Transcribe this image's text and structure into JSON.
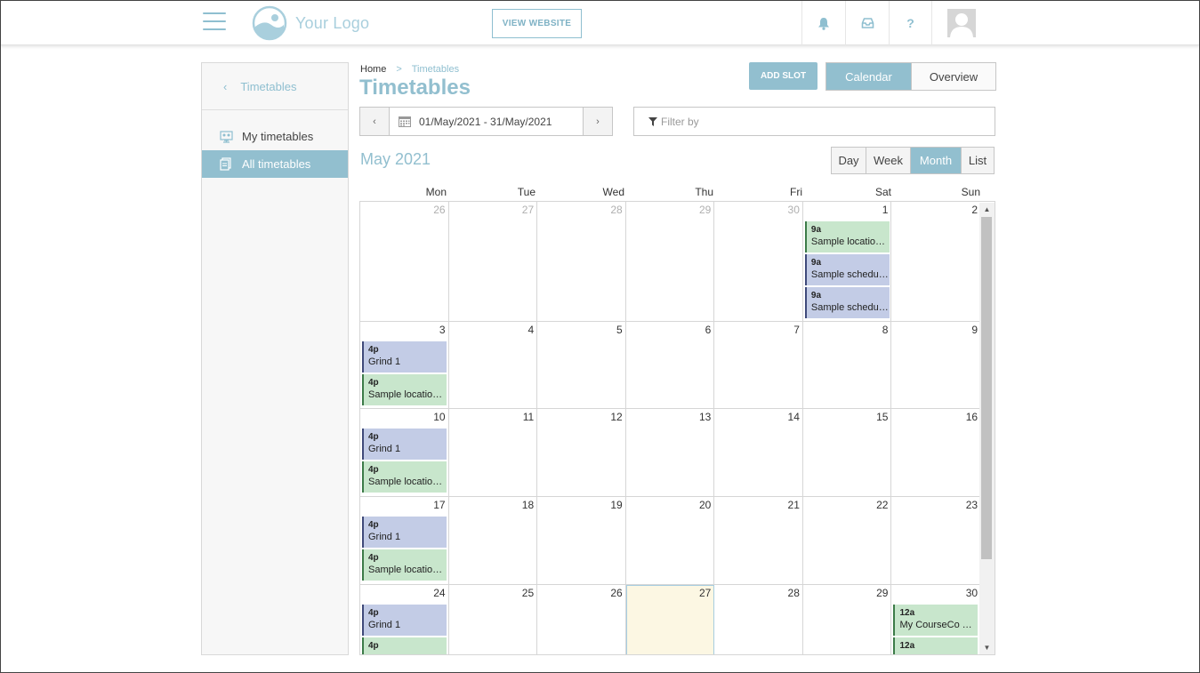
{
  "header": {
    "logo_text": "Your Logo",
    "view_website": "VIEW WEBSITE",
    "help_glyph": "?"
  },
  "sidebar": {
    "back_label": "Timetables",
    "items": [
      {
        "label": "My timetables",
        "icon": "monitor-users-icon",
        "active": false
      },
      {
        "label": "All timetables",
        "icon": "document-stack-icon",
        "active": true
      }
    ]
  },
  "breadcrumb": {
    "home": "Home",
    "sep": ">",
    "current": "Timetables"
  },
  "page_title": "Timetables",
  "toolbar": {
    "add_slot": "ADD SLOT",
    "calendar": "Calendar",
    "overview": "Overview"
  },
  "date_nav": {
    "prev": "‹",
    "next": "›",
    "range": "01/May/2021 - 31/May/2021",
    "filter_placeholder": "Filter by"
  },
  "calendar": {
    "month_title": "May 2021",
    "range_tabs": [
      "Day",
      "Week",
      "Month",
      "List"
    ],
    "active_tab": "Month",
    "weekdays": [
      "Mon",
      "Tue",
      "Wed",
      "Thu",
      "Fri",
      "Sat",
      "Sun"
    ],
    "weeks": [
      {
        "days": [
          {
            "num": "26",
            "other": true,
            "events": []
          },
          {
            "num": "27",
            "other": true,
            "events": []
          },
          {
            "num": "28",
            "other": true,
            "events": []
          },
          {
            "num": "29",
            "other": true,
            "events": []
          },
          {
            "num": "30",
            "other": true,
            "events": []
          },
          {
            "num": "1",
            "events": [
              {
                "time": "9a",
                "title": "Sample locatio…",
                "color": "green"
              },
              {
                "time": "9a",
                "title": "Sample schedul…",
                "color": "blue"
              },
              {
                "time": "9a",
                "title": "Sample schedul…",
                "color": "blue"
              }
            ]
          },
          {
            "num": "2",
            "events": []
          }
        ]
      },
      {
        "days": [
          {
            "num": "3",
            "events": [
              {
                "time": "4p",
                "title": "Grind 1",
                "color": "blue"
              },
              {
                "time": "4p",
                "title": "Sample locatio…",
                "color": "green"
              }
            ]
          },
          {
            "num": "4",
            "events": []
          },
          {
            "num": "5",
            "events": []
          },
          {
            "num": "6",
            "events": []
          },
          {
            "num": "7",
            "events": []
          },
          {
            "num": "8",
            "events": []
          },
          {
            "num": "9",
            "events": []
          }
        ]
      },
      {
        "days": [
          {
            "num": "10",
            "events": [
              {
                "time": "4p",
                "title": "Grind 1",
                "color": "blue"
              },
              {
                "time": "4p",
                "title": "Sample locatio…",
                "color": "green"
              }
            ]
          },
          {
            "num": "11",
            "events": []
          },
          {
            "num": "12",
            "events": []
          },
          {
            "num": "13",
            "events": []
          },
          {
            "num": "14",
            "events": []
          },
          {
            "num": "15",
            "events": []
          },
          {
            "num": "16",
            "events": []
          }
        ]
      },
      {
        "days": [
          {
            "num": "17",
            "events": [
              {
                "time": "4p",
                "title": "Grind 1",
                "color": "blue"
              },
              {
                "time": "4p",
                "title": "Sample locatio…",
                "color": "green"
              }
            ]
          },
          {
            "num": "18",
            "events": []
          },
          {
            "num": "19",
            "events": []
          },
          {
            "num": "20",
            "events": []
          },
          {
            "num": "21",
            "events": []
          },
          {
            "num": "22",
            "events": []
          },
          {
            "num": "23",
            "events": []
          }
        ]
      },
      {
        "days": [
          {
            "num": "24",
            "events": [
              {
                "time": "4p",
                "title": "Grind 1",
                "color": "blue"
              },
              {
                "time": "4p",
                "title": "",
                "color": "green"
              }
            ]
          },
          {
            "num": "25",
            "events": []
          },
          {
            "num": "26",
            "events": []
          },
          {
            "num": "27",
            "today": true,
            "events": []
          },
          {
            "num": "28",
            "events": []
          },
          {
            "num": "29",
            "events": []
          },
          {
            "num": "30",
            "events": [
              {
                "time": "12a",
                "title": "My CourseCo Tr…",
                "color": "green"
              },
              {
                "time": "12a",
                "title": "",
                "color": "green"
              }
            ]
          }
        ]
      }
    ]
  },
  "colors": {
    "accent": "#92bfcf",
    "event_blue": "#c3cce6",
    "event_green": "#c8e6cc",
    "today": "#fcf7e3"
  }
}
